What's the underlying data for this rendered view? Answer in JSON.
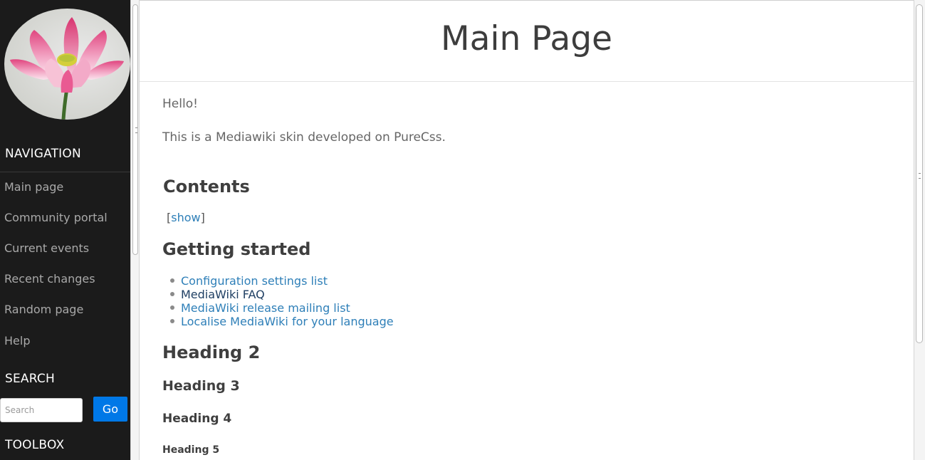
{
  "sidebar": {
    "navigation_title": "NAVIGATION",
    "nav_items": [
      {
        "label": "Main page"
      },
      {
        "label": "Community portal"
      },
      {
        "label": "Current events"
      },
      {
        "label": "Recent changes"
      },
      {
        "label": "Random page"
      },
      {
        "label": "Help"
      }
    ],
    "search_title": "SEARCH",
    "search_placeholder": "Search",
    "go_label": "Go",
    "toolbox_title": "TOOLBOX"
  },
  "main": {
    "title": "Main Page",
    "intro": [
      "Hello!",
      "This is a Mediawiki skin developed on PureCss."
    ],
    "contents_heading": "Contents",
    "toc_open": "[",
    "toc_show": "show",
    "toc_close": "]",
    "getting_started_heading": "Getting started",
    "links": [
      {
        "label": "Configuration settings list",
        "visited": false
      },
      {
        "label": "MediaWiki FAQ",
        "visited": true
      },
      {
        "label": "MediaWiki release mailing list",
        "visited": false
      },
      {
        "label": "Localise MediaWiki for your language",
        "visited": false
      }
    ],
    "heading2": "Heading 2",
    "heading3": "Heading 3",
    "heading4": "Heading 4",
    "heading5": "Heading 5"
  },
  "colors": {
    "sidebar_bg": "#1b1b1b",
    "go_button": "#0078e7",
    "link": "#2e7fb8",
    "link_visited": "#1f3f63"
  }
}
